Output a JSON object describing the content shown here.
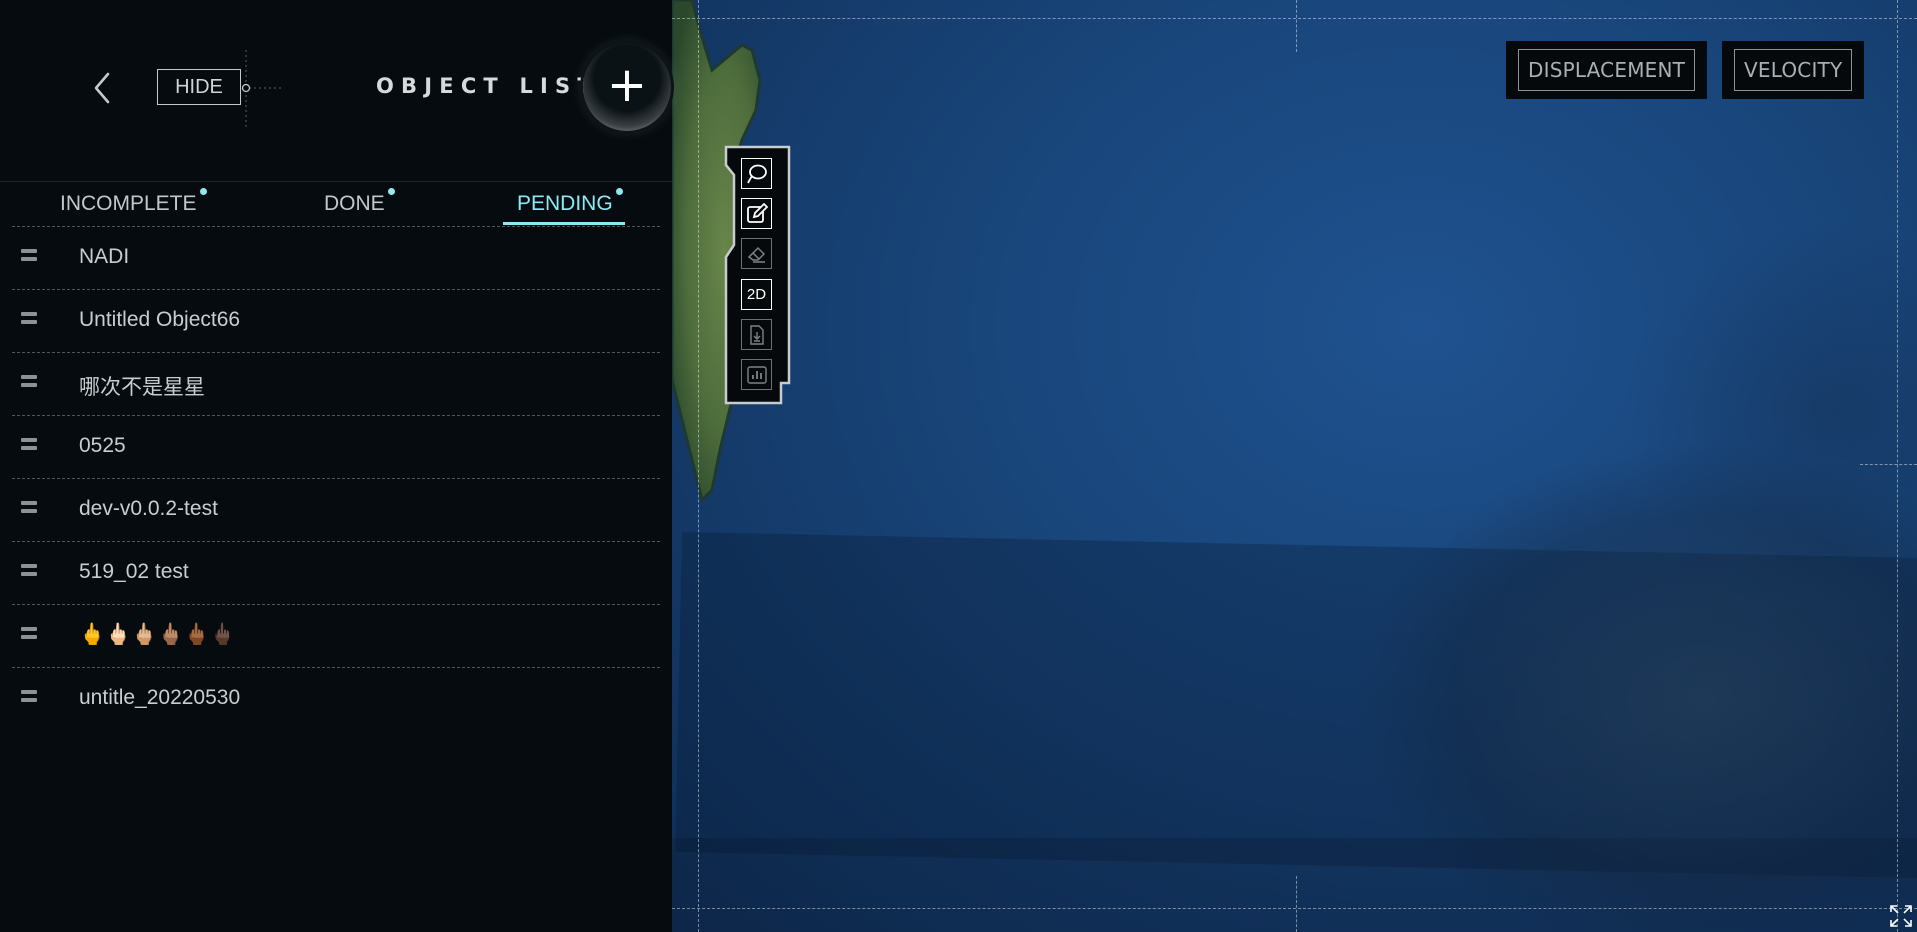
{
  "panel": {
    "hide_label": "HIDE",
    "title": "OBJECT LIST",
    "add_symbol": "+",
    "tabs": [
      {
        "label": "INCOMPLETE",
        "active": false
      },
      {
        "label": "DONE",
        "active": false
      },
      {
        "label": "PENDING",
        "active": true
      }
    ],
    "items": [
      {
        "label": "NADI"
      },
      {
        "label": "Untitled Object66"
      },
      {
        "label": "哪次不是星星"
      },
      {
        "label": "0525"
      },
      {
        "label": "dev-v0.0.2-test"
      },
      {
        "label": "519_02 test"
      },
      {
        "label": "🖕🖕🏻🖕🏼🖕🏽🖕🏾🖕🏿"
      },
      {
        "label": "untitle_20220530"
      }
    ]
  },
  "map": {
    "buttons": {
      "displacement": "DISPLACEMENT",
      "velocity": "VELOCITY"
    },
    "toolbar": {
      "tools": [
        {
          "icon": "lasso-icon",
          "state": "active"
        },
        {
          "icon": "edit-icon",
          "state": "active"
        },
        {
          "icon": "eraser-icon",
          "state": "disabled"
        },
        {
          "icon": "2d-icon",
          "label": "2D",
          "state": "active"
        },
        {
          "icon": "download-icon",
          "state": "disabled"
        },
        {
          "icon": "chart-icon",
          "state": "disabled"
        }
      ]
    }
  },
  "colors": {
    "panel_bg": "#050b0e",
    "accent": "#8fe9f4",
    "text": "#c9cdd0",
    "ocean": "#1a4a84"
  }
}
